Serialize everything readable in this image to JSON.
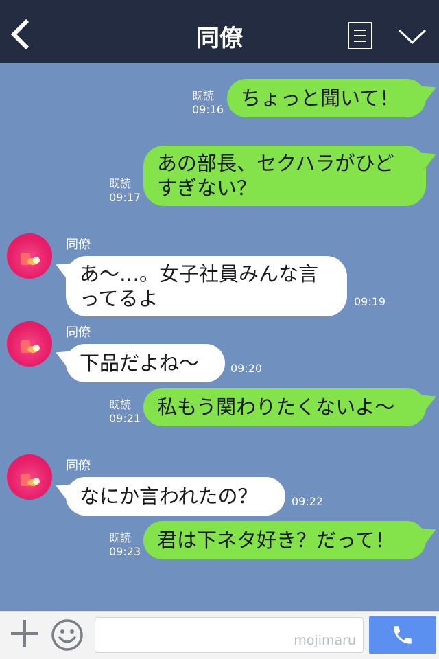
{
  "header": {
    "title": "同僚",
    "back_icon": "chevron-left-icon",
    "menu_icon": "list-icon",
    "collapse_icon": "chevron-down-icon"
  },
  "messages": [
    {
      "side": "me",
      "text": "ちょっと聞いて！",
      "read": "既読",
      "time": "09:16"
    },
    {
      "side": "me",
      "text": "あの部長、セクハラがひど すぎない？",
      "read": "既読",
      "time": "09:17"
    },
    {
      "side": "them",
      "sender": "同僚",
      "text": "あ〜…。女子社員みんな言 ってるよ",
      "time": "09:19"
    },
    {
      "side": "them",
      "sender": "同僚",
      "text": "下品だよね〜",
      "time": "09:20"
    },
    {
      "side": "me",
      "text": "私もう関わりたくないよ〜",
      "read": "既読",
      "time": "09:21"
    },
    {
      "side": "them",
      "sender": "同僚",
      "text": "なにか言われたの？",
      "time": "09:22"
    },
    {
      "side": "me",
      "text": "君は下ネタ好き？だって！",
      "read": "既読",
      "time": "09:23"
    }
  ],
  "input": {
    "watermark": "mojimaru"
  },
  "colors": {
    "header_bg": "#232c40",
    "chat_bg": "#7091c0",
    "my_bubble": "#84e34a",
    "their_bubble": "#ffffff",
    "call_button": "#5b8ff0"
  }
}
